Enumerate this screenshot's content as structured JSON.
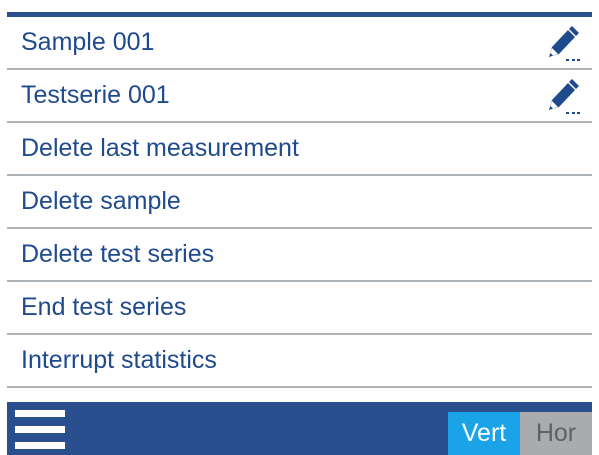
{
  "menu": {
    "items": [
      {
        "label": "Sample 001",
        "editable": true,
        "edit_icon": "pencil-icon"
      },
      {
        "label": "Testserie 001",
        "editable": true,
        "edit_icon": "pencil-icon"
      },
      {
        "label": "Delete last measurement",
        "editable": false
      },
      {
        "label": "Delete sample",
        "editable": false
      },
      {
        "label": "Delete test series",
        "editable": false
      },
      {
        "label": "End test series",
        "editable": false
      },
      {
        "label": "Interrupt statistics",
        "editable": false
      }
    ]
  },
  "bottom_bar": {
    "menu_icon": "hamburger-menu-icon",
    "orientation_toggle": {
      "vertical_label": "Vert",
      "horizontal_label": "Hor",
      "selected": "Vert"
    }
  },
  "colors": {
    "brand_blue": "#2a4f8f",
    "text_blue": "#1f4a8c",
    "accent_cyan": "#1ba3e8",
    "inactive_gray": "#a9abad",
    "divider_gray": "#aeb3b8"
  }
}
